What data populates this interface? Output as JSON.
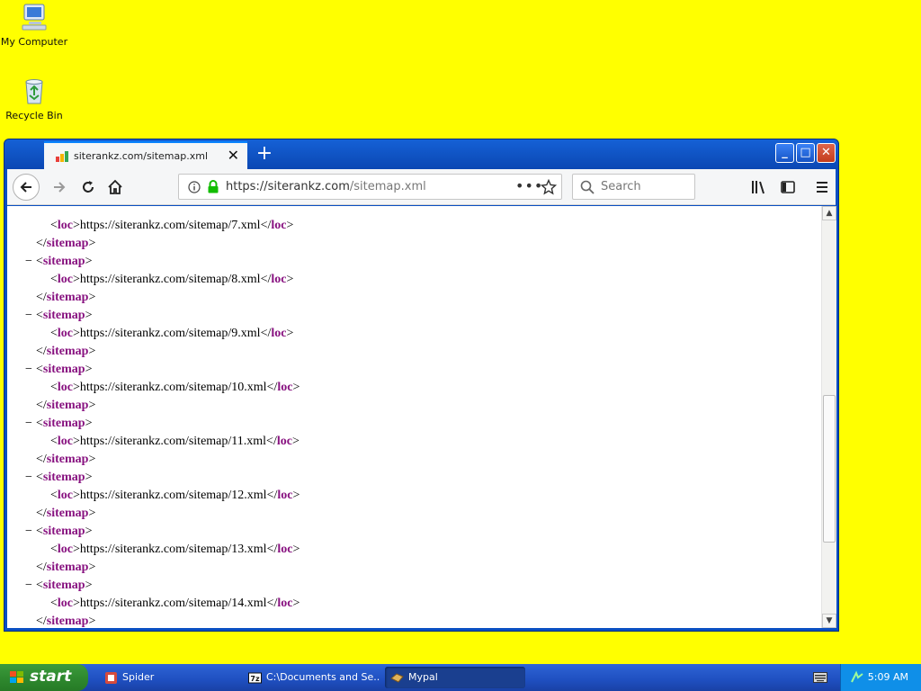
{
  "desktop": {
    "icons": [
      {
        "label": "My Computer"
      },
      {
        "label": "Recycle Bin"
      }
    ]
  },
  "browser": {
    "tab_title": "siterankz.com/sitemap.xml",
    "url_host": "https://siterankz.com",
    "url_path": "/sitemap.xml",
    "search_placeholder": "Search",
    "xml_lines": [
      {
        "indent": 2,
        "text": "https://siterankz.com/sitemap/7.xml",
        "kind": "loc"
      },
      {
        "indent": 1,
        "kind": "close"
      },
      {
        "indent": 1,
        "kind": "open"
      },
      {
        "indent": 2,
        "text": "https://siterankz.com/sitemap/8.xml",
        "kind": "loc"
      },
      {
        "indent": 1,
        "kind": "close"
      },
      {
        "indent": 1,
        "kind": "open"
      },
      {
        "indent": 2,
        "text": "https://siterankz.com/sitemap/9.xml",
        "kind": "loc"
      },
      {
        "indent": 1,
        "kind": "close"
      },
      {
        "indent": 1,
        "kind": "open"
      },
      {
        "indent": 2,
        "text": "https://siterankz.com/sitemap/10.xml",
        "kind": "loc"
      },
      {
        "indent": 1,
        "kind": "close"
      },
      {
        "indent": 1,
        "kind": "open"
      },
      {
        "indent": 2,
        "text": "https://siterankz.com/sitemap/11.xml",
        "kind": "loc"
      },
      {
        "indent": 1,
        "kind": "close"
      },
      {
        "indent": 1,
        "kind": "open"
      },
      {
        "indent": 2,
        "text": "https://siterankz.com/sitemap/12.xml",
        "kind": "loc"
      },
      {
        "indent": 1,
        "kind": "close"
      },
      {
        "indent": 1,
        "kind": "open"
      },
      {
        "indent": 2,
        "text": "https://siterankz.com/sitemap/13.xml",
        "kind": "loc"
      },
      {
        "indent": 1,
        "kind": "close"
      },
      {
        "indent": 1,
        "kind": "open"
      },
      {
        "indent": 2,
        "text": "https://siterankz.com/sitemap/14.xml",
        "kind": "loc"
      },
      {
        "indent": 1,
        "kind": "close"
      }
    ],
    "tags": {
      "sitemap": "sitemap",
      "loc": "loc"
    }
  },
  "taskbar": {
    "start_label": "start",
    "tasks": [
      {
        "label": "Spider"
      },
      {
        "label": "C:\\Documents and Se..."
      },
      {
        "label": "Mypal"
      }
    ],
    "clock": "5:09 AM"
  },
  "colors": {
    "desktop_bg": "#ffff00",
    "xml_tag": "#881280",
    "titlebar": "#0b47b3"
  },
  "icons": [
    "my-computer-icon",
    "recycle-bin-icon",
    "back-icon",
    "forward-icon",
    "reload-icon",
    "home-icon",
    "info-icon",
    "lock-icon",
    "page-actions-icon",
    "bookmark-star-icon",
    "search-icon",
    "library-icon",
    "sidebar-icon",
    "menu-icon"
  ]
}
